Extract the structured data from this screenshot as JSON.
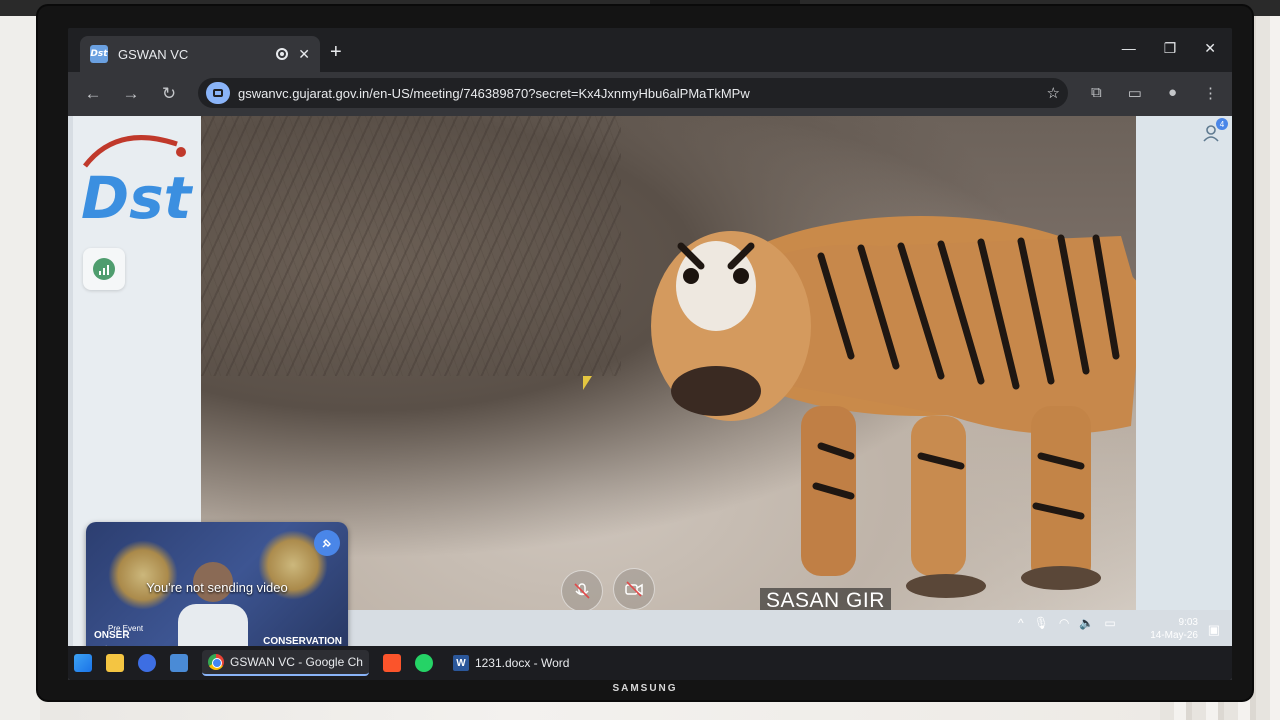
{
  "tab": {
    "title": "GSWAN VC",
    "favicon": "Dst"
  },
  "toolbar": {
    "url": "gswanvc.gujarat.gov.in/en-US/meeting/746389870?secret=Kx4JxnmyHbu6alPMaTkMPw"
  },
  "meeting": {
    "participant_name": "SASAN GIR",
    "participants_count": "4",
    "self_view": {
      "message": "You're not sending video",
      "banner_left": "Pre Event",
      "banner_bottom_left": "ONSER",
      "banner_right": "CONSERVATION"
    }
  },
  "system_tray": {
    "time": "9:03",
    "date": "14-May-26"
  },
  "taskbar": {
    "items": [
      {
        "label": "GSWAN VC - Google Ch",
        "icon": "chrome-icon"
      },
      {
        "label": "1231.docx - Word",
        "icon": "word-icon"
      }
    ]
  },
  "monitor": {
    "brand": "SAMSUNG"
  },
  "colors": {
    "accent": "#4a86e8",
    "chrome_dark": "#202124",
    "omnibox_chip": "#8ab4f8"
  }
}
